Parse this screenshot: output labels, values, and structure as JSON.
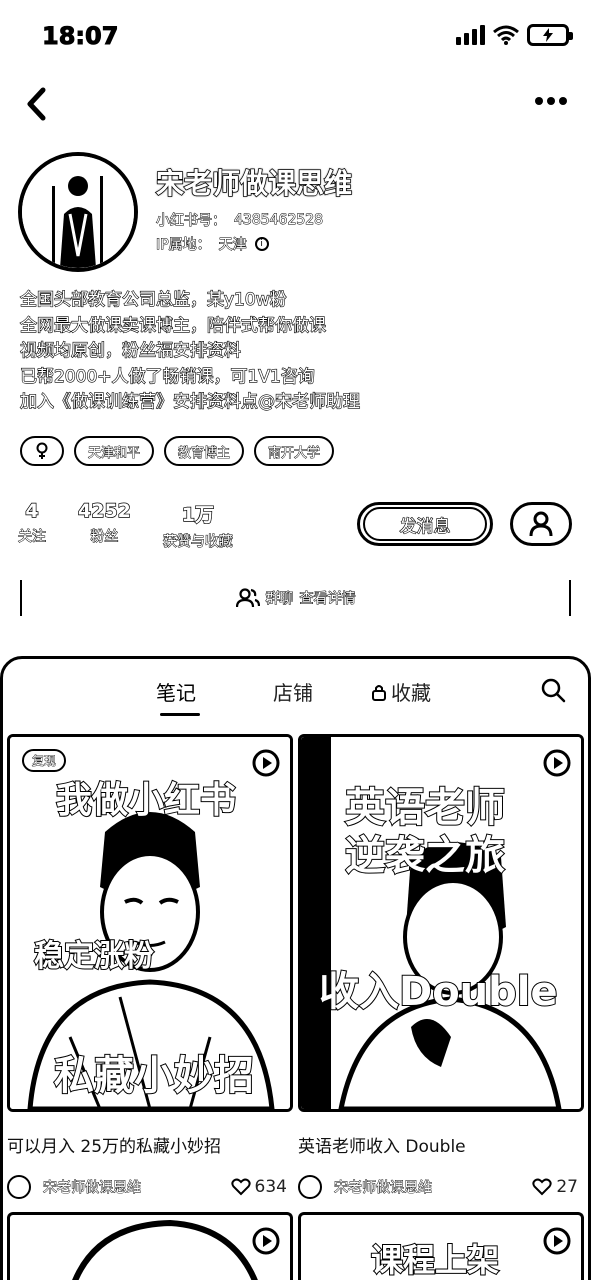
{
  "status_bar": {
    "time": "18:07",
    "battery_icon": "battery-charging-icon"
  },
  "nav": {
    "back_icon": "back-arrow-icon",
    "more_icon": "more-icon"
  },
  "profile": {
    "name": "宋老师做课思维",
    "id_label": "小红书号：",
    "id_value": "4385462528",
    "ip_label": "IP属地：",
    "ip_value": "天津"
  },
  "bio": [
    "全国头部教育公司总监，某y10w粉",
    "全网最大做课卖课博主，陪伴式帮你做课",
    "视频均原创，粉丝福安排资料",
    "已帮2000+人做了畅销课，可1V1咨询",
    "加入《做课训练营》安排资料点@宋老师助理"
  ],
  "tags": [
    "天津和平",
    "教育博主",
    "南开大学"
  ],
  "stats": [
    {
      "value": "4",
      "label": "关注"
    },
    {
      "value": "4252",
      "label": "粉丝"
    },
    {
      "value": "1万",
      "label": "获赞与收藏"
    }
  ],
  "actions": {
    "message": "发消息"
  },
  "group": {
    "label": "群聊",
    "link": "查看详情"
  },
  "tabs": {
    "notes": "笔记",
    "shop": "店铺",
    "favorites": "收藏"
  },
  "notes": [
    {
      "badge": "复现",
      "overlay_top": "我做小红书",
      "overlay_mid": "稳定涨粉",
      "overlay_bottom": "私藏小妙招",
      "title": "可以月入 25万的私藏小妙招",
      "author": "宋老师做课思维",
      "likes": "634"
    },
    {
      "overlay_top": "英语老师",
      "overlay_top2": "逆袭之旅",
      "overlay_mid": "收入Double",
      "title": "英语老师收入 Double",
      "author": "宋老师做课思维",
      "likes": "27"
    }
  ],
  "next_row": {
    "overlay": "课程上架"
  }
}
